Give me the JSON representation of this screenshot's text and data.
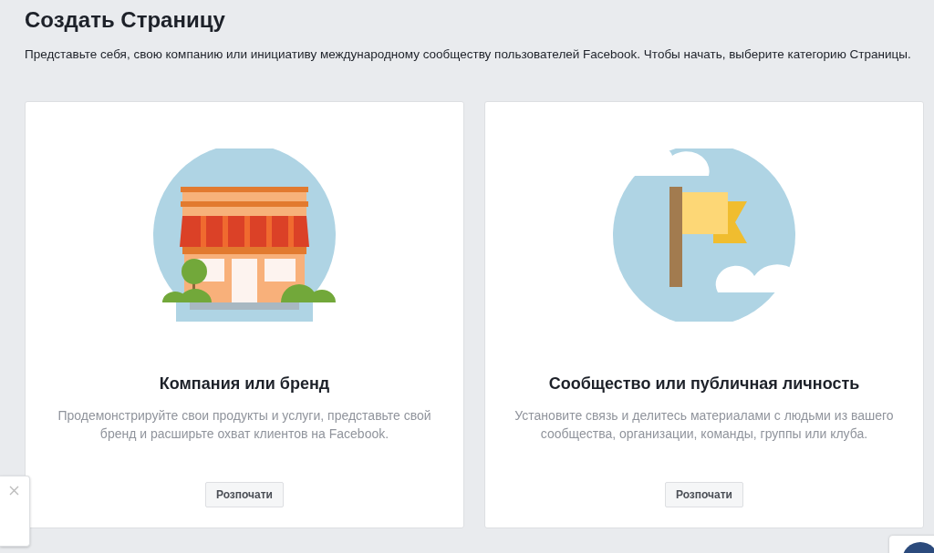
{
  "page": {
    "title": "Создать Страницу",
    "description": "Представьте себя, свою компанию или инициативу международному сообществу пользователей Facebook. Чтобы начать, выберите категорию Страницы."
  },
  "cards": [
    {
      "kind": "store",
      "title": "Компания или бренд",
      "description": "Продемонстрируйте свои продукты и услуги, представьте свой бренд и расширьте охват клиентов на Facebook.",
      "button": "Розпочати"
    },
    {
      "kind": "flag",
      "title": "Сообщество или публичная личность",
      "description": "Установите связь и делитесь материалами с людьми из вашего сообщества, организации, команды, группы или клуба.",
      "button": "Розпочати"
    }
  ]
}
